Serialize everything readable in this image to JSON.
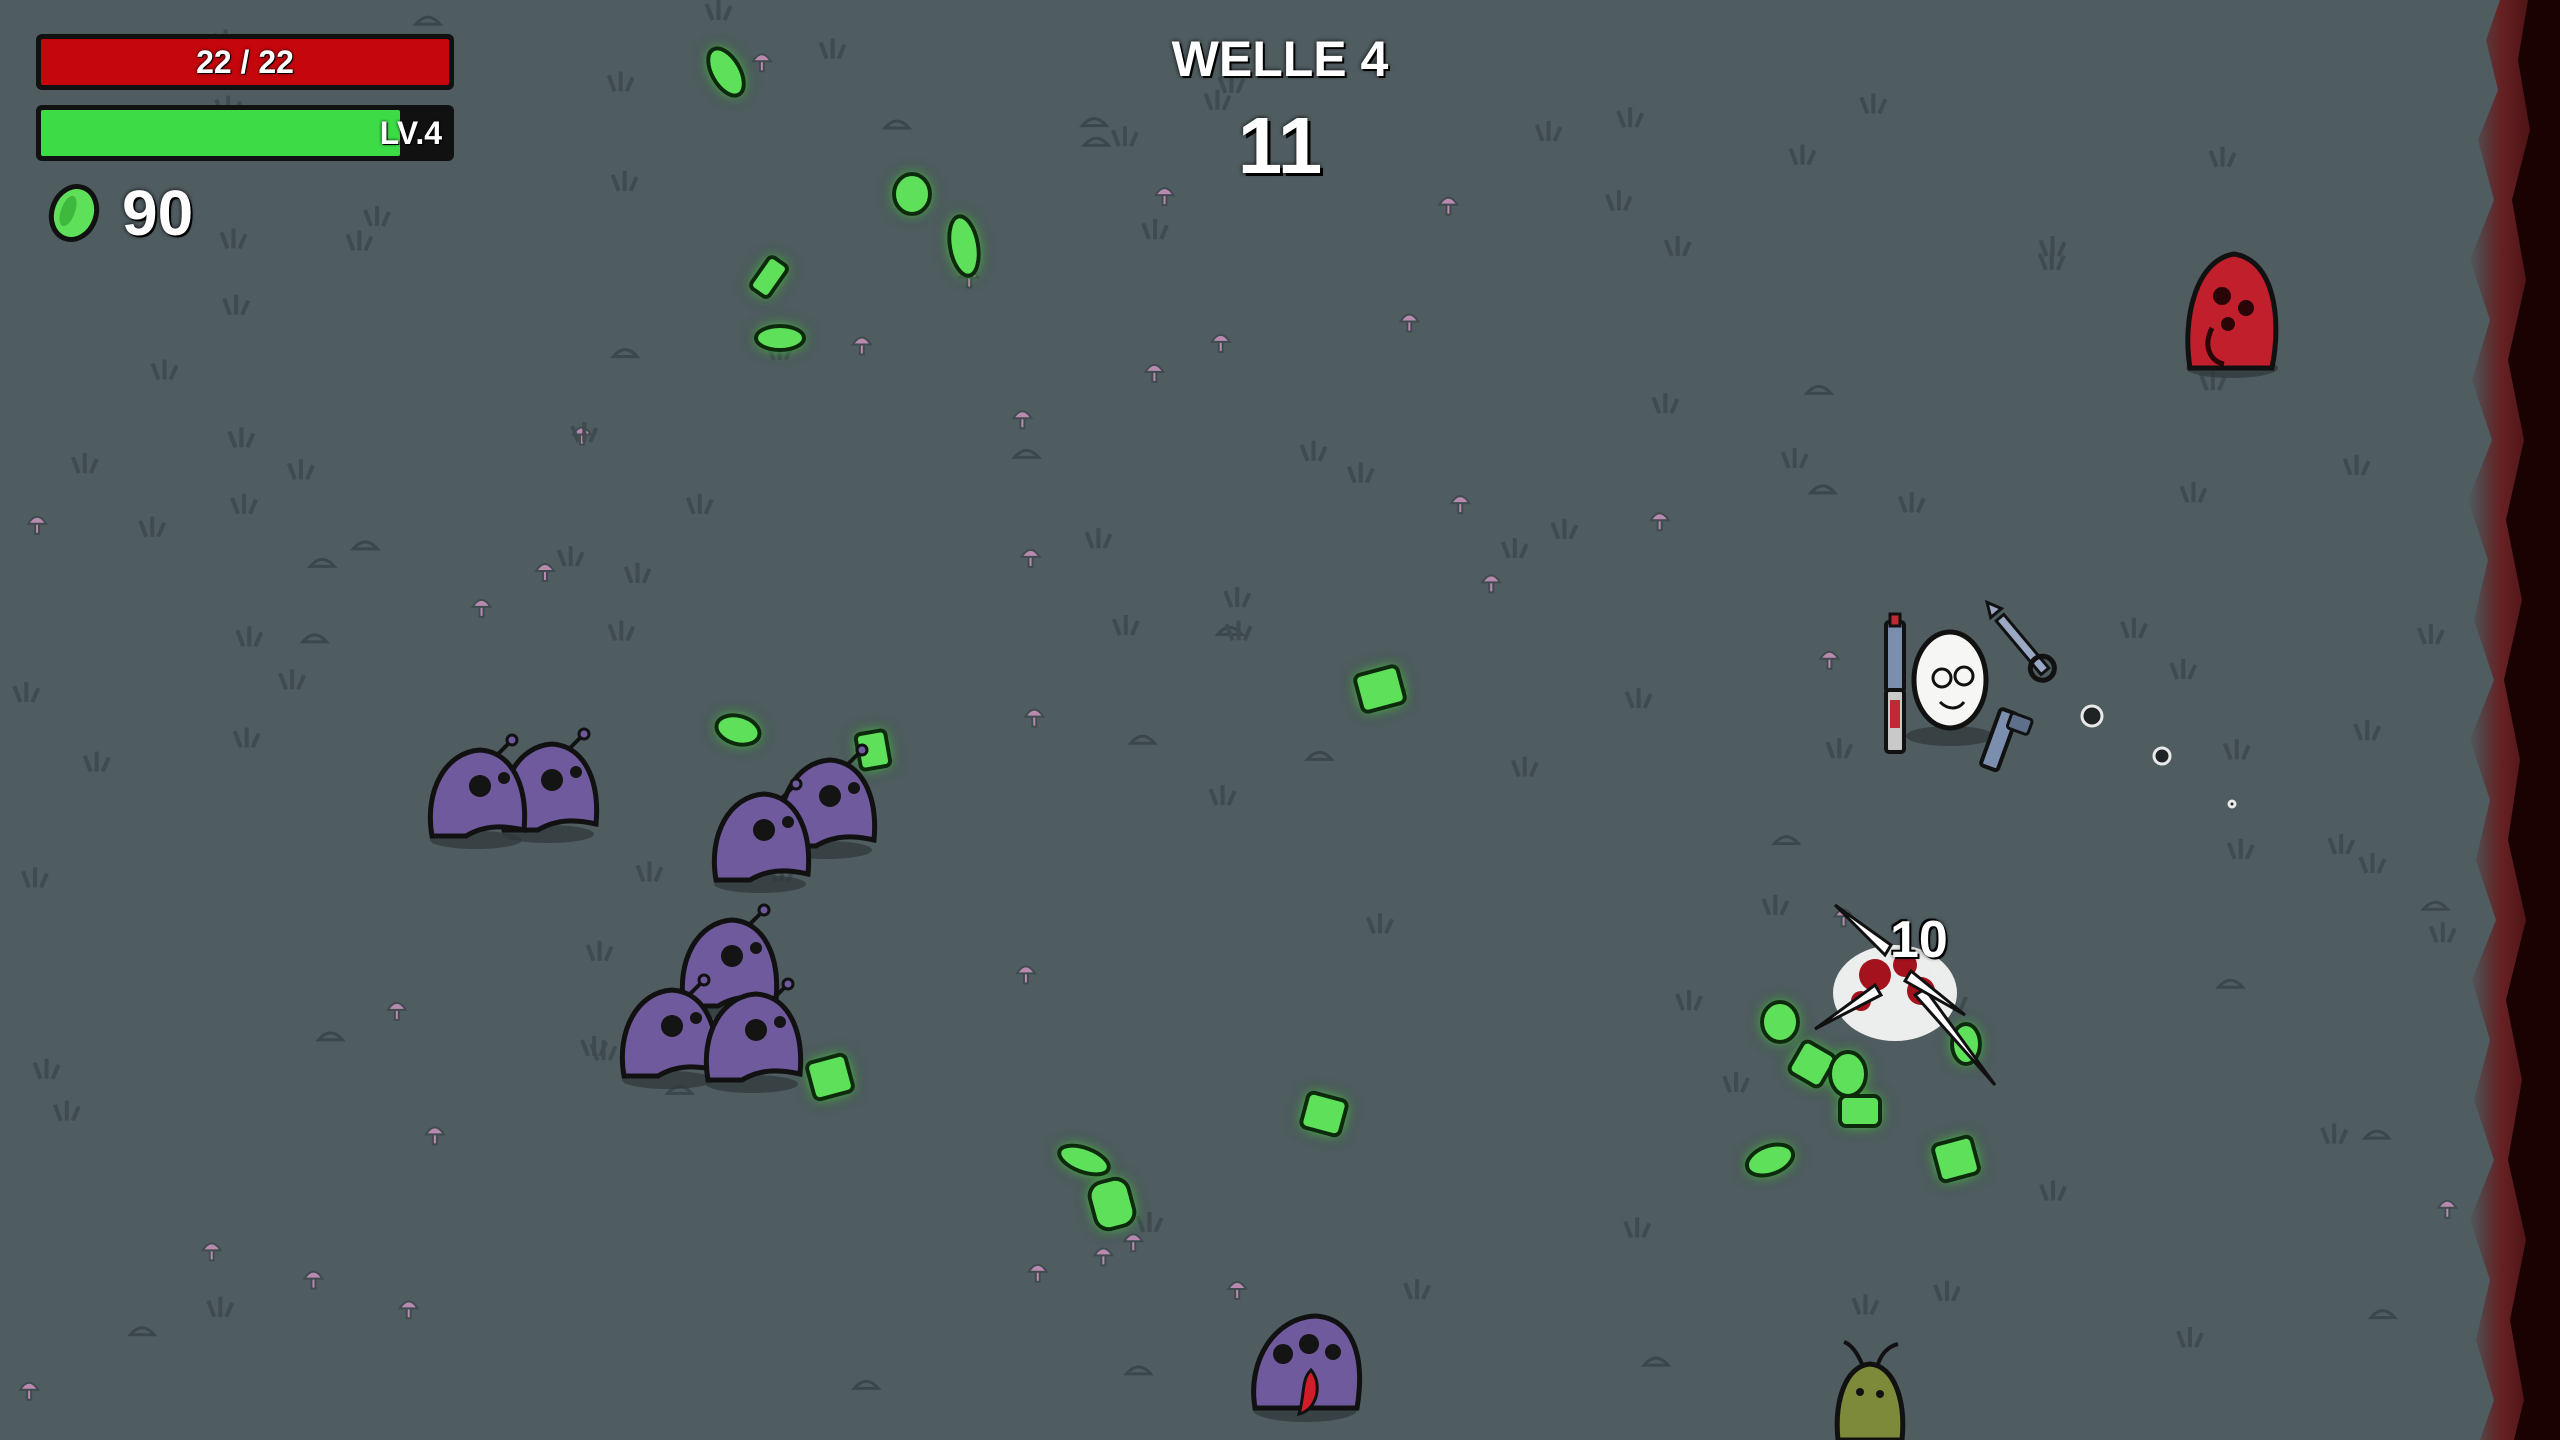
{
  "hud": {
    "health_text": "22 / 22",
    "health_fraction": 1.0,
    "level_text": "LV.4",
    "xp_fraction": 0.88,
    "materials_count": "90",
    "materials_icon": "material-icon"
  },
  "wave": {
    "title": "WELLE 4",
    "timer": "11"
  },
  "combat": {
    "damage_number": "10"
  },
  "colors": {
    "ground": "#4f5c60",
    "health": "#c5060c",
    "xp": "#3ddc47",
    "material": "#5fe05a",
    "enemy_purple": "#6e5a9c",
    "enemy_red": "#c01f2b",
    "border_damage": "#3a0b0c"
  },
  "entities": {
    "player": "potato-player",
    "weapons": [
      "smg-weapon",
      "wrench-weapon",
      "pistol-weapon",
      "shotgun-weapon"
    ],
    "enemies": [
      "baby-alien",
      "baby-alien",
      "baby-alien",
      "baby-alien",
      "baby-alien",
      "baby-alien",
      "baby-alien",
      "tongue-alien",
      "charger-alien",
      "tree-enemy"
    ]
  }
}
